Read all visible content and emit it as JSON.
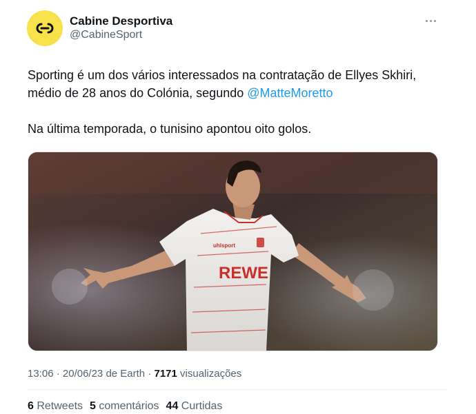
{
  "author": {
    "name": "Cabine Desportiva",
    "handle": "@CabineSport",
    "avatar_color": "#f7e24b",
    "avatar_icon": "cd-logo-icon"
  },
  "tweet": {
    "line1_prefix": "Sporting é um dos vários interessados na contratação de Ellyes Skhiri, médio de 28 anos do Colónia, segundo ",
    "mention": "@MatteMoretto",
    "paragraph2": "Na última temporada, o tunisino apontou oito golos."
  },
  "media": {
    "jersey_sponsor": "REWE",
    "jersey_brand": "uhlsport"
  },
  "meta": {
    "time": "13:06",
    "dot1": " · ",
    "date": "20/06/23 de Earth",
    "dot2": " · ",
    "views_count": "7171",
    "views_label": " visualizações"
  },
  "stats": {
    "retweets_count": "6",
    "retweets_label": " Retweets",
    "comments_count": "5",
    "comments_label": " comentários",
    "likes_count": "44",
    "likes_label": " Curtidas"
  },
  "colors": {
    "mention": "#1d9bf0",
    "secondary_text": "#536471",
    "primary_text": "#0f1419"
  }
}
